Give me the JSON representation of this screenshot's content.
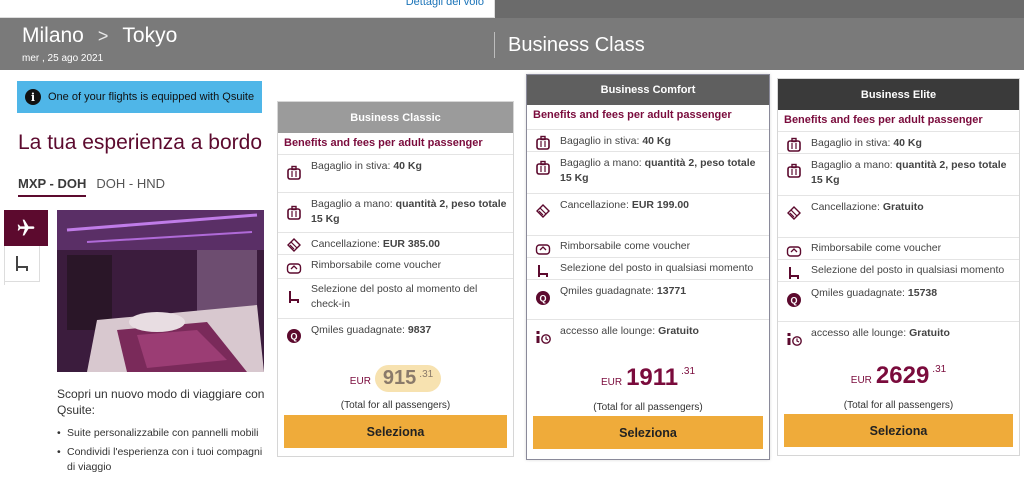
{
  "top_bar": {
    "details_link": "Dettagli del volo"
  },
  "header": {
    "from_city": "Milano",
    "to_city": "Tokyo",
    "arrow": ">",
    "date": "mer , 25 ago 2021",
    "cabin": "Business Class"
  },
  "info_banner": {
    "icon": "i",
    "text": "One of your flights is equipped with Qsuite"
  },
  "experience": {
    "title": "La tua esperienza a bordo",
    "segments": [
      {
        "label": "MXP - DOH"
      },
      {
        "label": "DOH - HND"
      }
    ],
    "side_tabs": [
      {
        "icon": "plane-icon"
      },
      {
        "icon": "seat-icon"
      }
    ],
    "description": "Scopri un nuovo modo di viaggiare con Qsuite:",
    "bullets": [
      "Suite personalizzabile con pannelli mobili",
      "Condividi l'esperienza con i tuoi compagni di viaggio"
    ]
  },
  "fares": [
    {
      "name": "Business Classic",
      "benefits_title": "Benefits and fees per adult passenger",
      "rows": [
        {
          "icon": "checked-bag-icon",
          "label": "Bagaglio in stiva:",
          "value": "40 Kg"
        },
        {
          "icon": "hand-bag-icon",
          "label": "Bagaglio a mano:",
          "value": "quantità 2, peso totale 15 Kg"
        },
        {
          "icon": "cancellation-icon",
          "label": "Cancellazione:",
          "value": "EUR 385.00"
        },
        {
          "icon": "voucher-icon",
          "label": "Rimborsabile come voucher",
          "value": ""
        },
        {
          "icon": "seat-select-icon",
          "label": "Selezione del posto al momento del check-in",
          "value": ""
        },
        {
          "icon": "qmiles-icon",
          "label": "Qmiles guadagnate:",
          "value": "9837"
        }
      ],
      "currency": "EUR",
      "amount": "915",
      "decimals": ".31",
      "total_note": "(Total for all passengers)",
      "button": "Seleziona"
    },
    {
      "name": "Business Comfort",
      "benefits_title": "Benefits and fees per adult passenger",
      "rows": [
        {
          "icon": "checked-bag-icon",
          "label": "Bagaglio in stiva:",
          "value": "40 Kg"
        },
        {
          "icon": "hand-bag-icon",
          "label": "Bagaglio a mano:",
          "value": "quantità 2, peso totale 15 Kg"
        },
        {
          "icon": "cancellation-icon",
          "label": "Cancellazione:",
          "value": "EUR 199.00"
        },
        {
          "icon": "voucher-icon",
          "label": "Rimborsabile come voucher",
          "value": ""
        },
        {
          "icon": "seat-select-icon",
          "label": "Selezione del posto in qualsiasi momento",
          "value": ""
        },
        {
          "icon": "qmiles-icon",
          "label": "Qmiles guadagnate:",
          "value": "13771"
        },
        {
          "icon": "lounge-icon",
          "label": "accesso alle lounge:",
          "value": "Gratuito"
        }
      ],
      "currency": "EUR",
      "amount": "1911",
      "decimals": ".31",
      "total_note": "(Total for all passengers)",
      "button": "Seleziona"
    },
    {
      "name": "Business Elite",
      "benefits_title": "Benefits and fees per adult passenger",
      "rows": [
        {
          "icon": "checked-bag-icon",
          "label": "Bagaglio in stiva:",
          "value": "40 Kg"
        },
        {
          "icon": "hand-bag-icon",
          "label": "Bagaglio a mano:",
          "value": "quantità 2, peso totale 15 Kg"
        },
        {
          "icon": "cancellation-icon",
          "label": "Cancellazione:",
          "value": "Gratuito"
        },
        {
          "icon": "voucher-icon",
          "label": "Rimborsabile come voucher",
          "value": ""
        },
        {
          "icon": "seat-select-icon",
          "label": "Selezione del posto in qualsiasi momento",
          "value": ""
        },
        {
          "icon": "qmiles-icon",
          "label": "Qmiles guadagnate:",
          "value": "15738"
        },
        {
          "icon": "lounge-icon",
          "label": "accesso alle lounge:",
          "value": "Gratuito"
        }
      ],
      "currency": "EUR",
      "amount": "2629",
      "decimals": ".31",
      "total_note": "(Total for all passengers)",
      "button": "Seleziona"
    }
  ],
  "colors": {
    "brand": "#5c0a2e",
    "button": "#efab3a",
    "banner": "#4fb6e8",
    "header": "#7a7a7a"
  }
}
